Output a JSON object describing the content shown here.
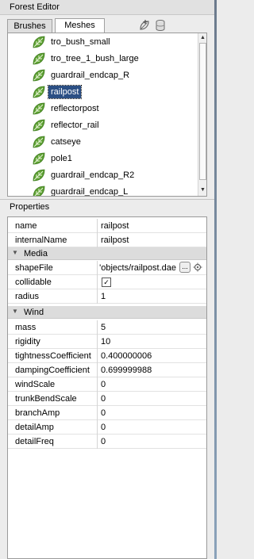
{
  "window": {
    "title": "Forest Editor"
  },
  "tabs": [
    {
      "label": "Brushes",
      "active": false
    },
    {
      "label": "Meshes",
      "active": true
    }
  ],
  "toolbar_icons": [
    "add-mesh-icon",
    "delete-database-icon"
  ],
  "tree": {
    "items": [
      {
        "label": "tro_bush_small",
        "selected": false
      },
      {
        "label": "tro_tree_1_bush_large",
        "selected": false
      },
      {
        "label": "guardrail_endcap_R",
        "selected": false
      },
      {
        "label": "railpost",
        "selected": true
      },
      {
        "label": "reflectorpost",
        "selected": false
      },
      {
        "label": "reflector_rail",
        "selected": false
      },
      {
        "label": "catseye",
        "selected": false
      },
      {
        "label": "pole1",
        "selected": false
      },
      {
        "label": "guardrail_endcap_R2",
        "selected": false
      },
      {
        "label": "guardrail_endcap_L",
        "selected": false
      }
    ],
    "scroll_up": "▲",
    "scroll_down": "▼"
  },
  "properties": {
    "header": "Properties",
    "general": [
      {
        "key": "name",
        "value": "railpost"
      },
      {
        "key": "internalName",
        "value": "railpost"
      }
    ],
    "media": {
      "label": "Media",
      "shapeFile": {
        "key": "shapeFile",
        "value": "'objects/railpost.dae",
        "button": "..."
      },
      "collidable": {
        "key": "collidable",
        "checked": true,
        "mark": "✓"
      },
      "radius": {
        "key": "radius",
        "value": "1"
      }
    },
    "wind": {
      "label": "Wind",
      "rows": [
        {
          "key": "mass",
          "value": "5"
        },
        {
          "key": "rigidity",
          "value": "10"
        },
        {
          "key": "tightnessCoefficient",
          "value": "0.400000006"
        },
        {
          "key": "dampingCoefficient",
          "value": "0.699999988"
        },
        {
          "key": "windScale",
          "value": "0"
        },
        {
          "key": "trunkBendScale",
          "value": "0"
        },
        {
          "key": "branchAmp",
          "value": "0"
        },
        {
          "key": "detailAmp",
          "value": "0"
        },
        {
          "key": "detailFreq",
          "value": "0"
        }
      ]
    },
    "category_arrow": "▼"
  },
  "colors": {
    "selection": "#2b4f84",
    "leaf_green": "#5ea034",
    "category_bg": "#dcdcdc"
  }
}
